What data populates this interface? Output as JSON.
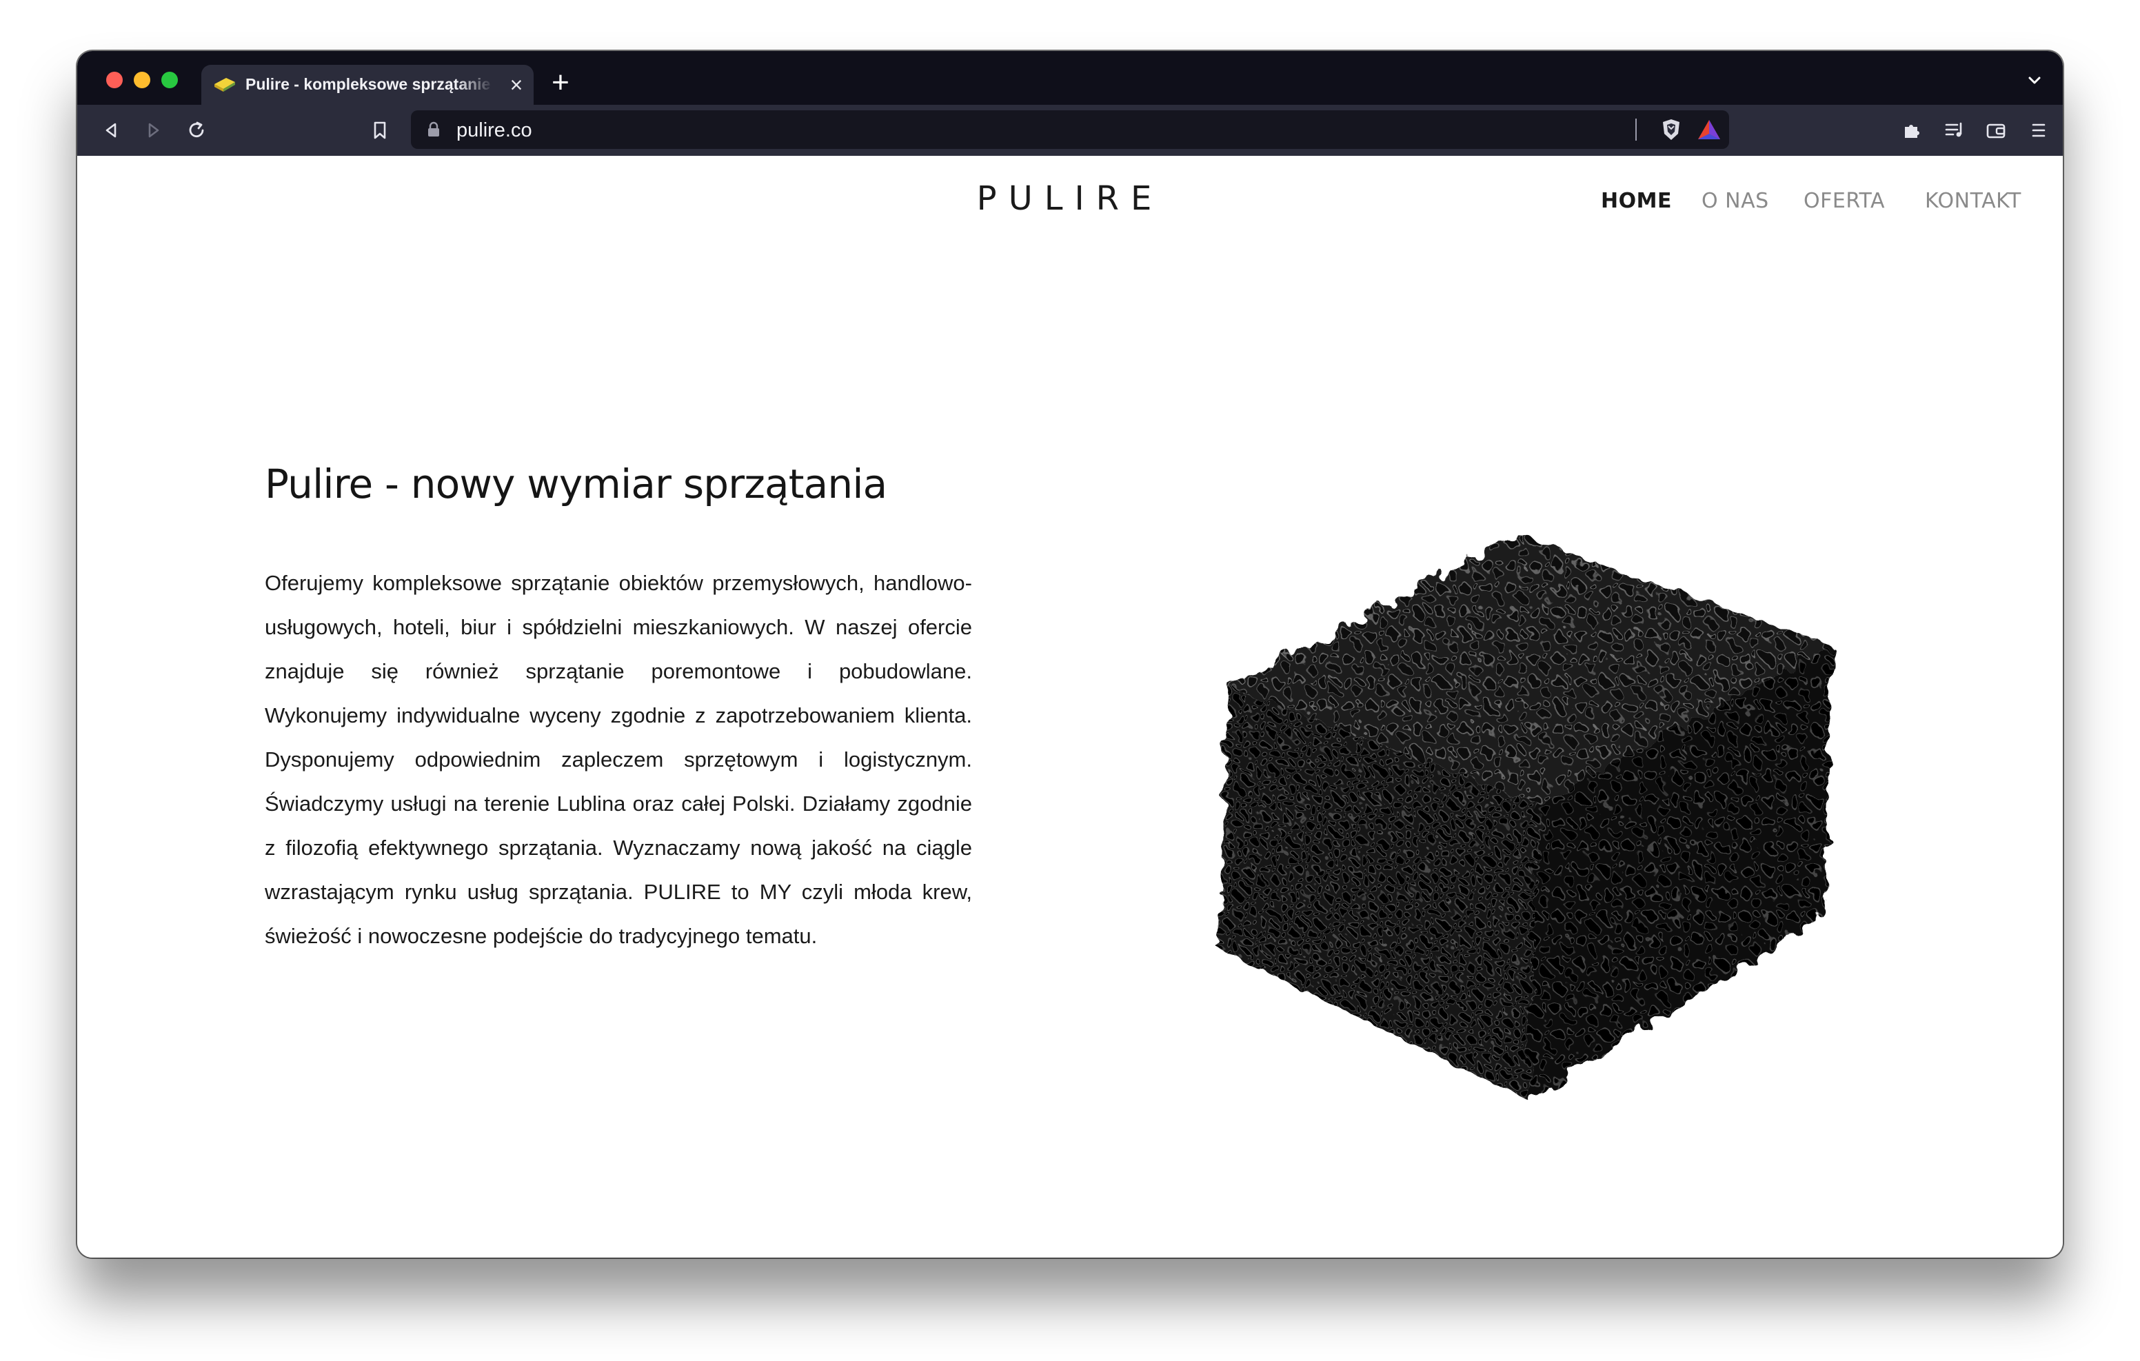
{
  "browser": {
    "tab": {
      "title": "Pulire - kompleksowe sprzątanie",
      "close_icon": "close-icon",
      "favicon": "sponge-favicon"
    },
    "new_tab_icon": "plus-icon",
    "tab_list_icon": "chevron-down-icon",
    "toolbar": {
      "back_icon": "back-icon",
      "forward_icon": "forward-icon",
      "reload_icon": "reload-icon",
      "bookmark_icon": "bookmark-icon",
      "extensions_icon": "puzzle-icon",
      "playlist_icon": "playlist-icon",
      "wallet_icon": "wallet-icon",
      "menu_icon": "hamburger-icon"
    },
    "url": "pulire.co",
    "url_lock_icon": "lock-icon",
    "shields_icon": "brave-shield-icon",
    "rewards_icon": "brave-rewards-icon"
  },
  "site": {
    "logo": "PULIRE",
    "nav": [
      {
        "label": "HOME",
        "active": true
      },
      {
        "label": "O NAS",
        "active": false
      },
      {
        "label": "OFERTA",
        "active": false
      },
      {
        "label": "KONTAKT",
        "active": false
      }
    ],
    "hero": {
      "headline": "Pulire - nowy wymiar sprzątania",
      "body": "Oferujemy kompleksowe sprzątanie obiektów przemysłowych, handlowo-usługowych, hoteli, biur i spółdzielni mieszkaniowych. W naszej ofercie znajduje się również sprzątanie poremontowe i pobudowlane. Wykonujemy indywidualne wyceny zgodnie z zapotrzebowaniem klienta. Dysponujemy odpowiednim zapleczem sprzętowym i logistycznym. Świadczymy usługi na terenie Lublina oraz całej Polski. Działamy zgodnie z filozofią efektywnego sprzątania. Wyznaczamy nową jakość na ciągle wzrastającym rynku usług sprzątania. PULIRE to MY czyli młoda krew, świeżość i nowoczesne podejście do tradycyjnego tematu.",
      "image": "black-sponge-cube-image"
    }
  },
  "colors": {
    "tabstrip_bg": "#0f0f1a",
    "toolbar_bg": "#2b2c3b",
    "urlbar_bg": "#15151f",
    "nav_active": "#1a1a1a",
    "nav_inactive": "#8a8a8a"
  }
}
